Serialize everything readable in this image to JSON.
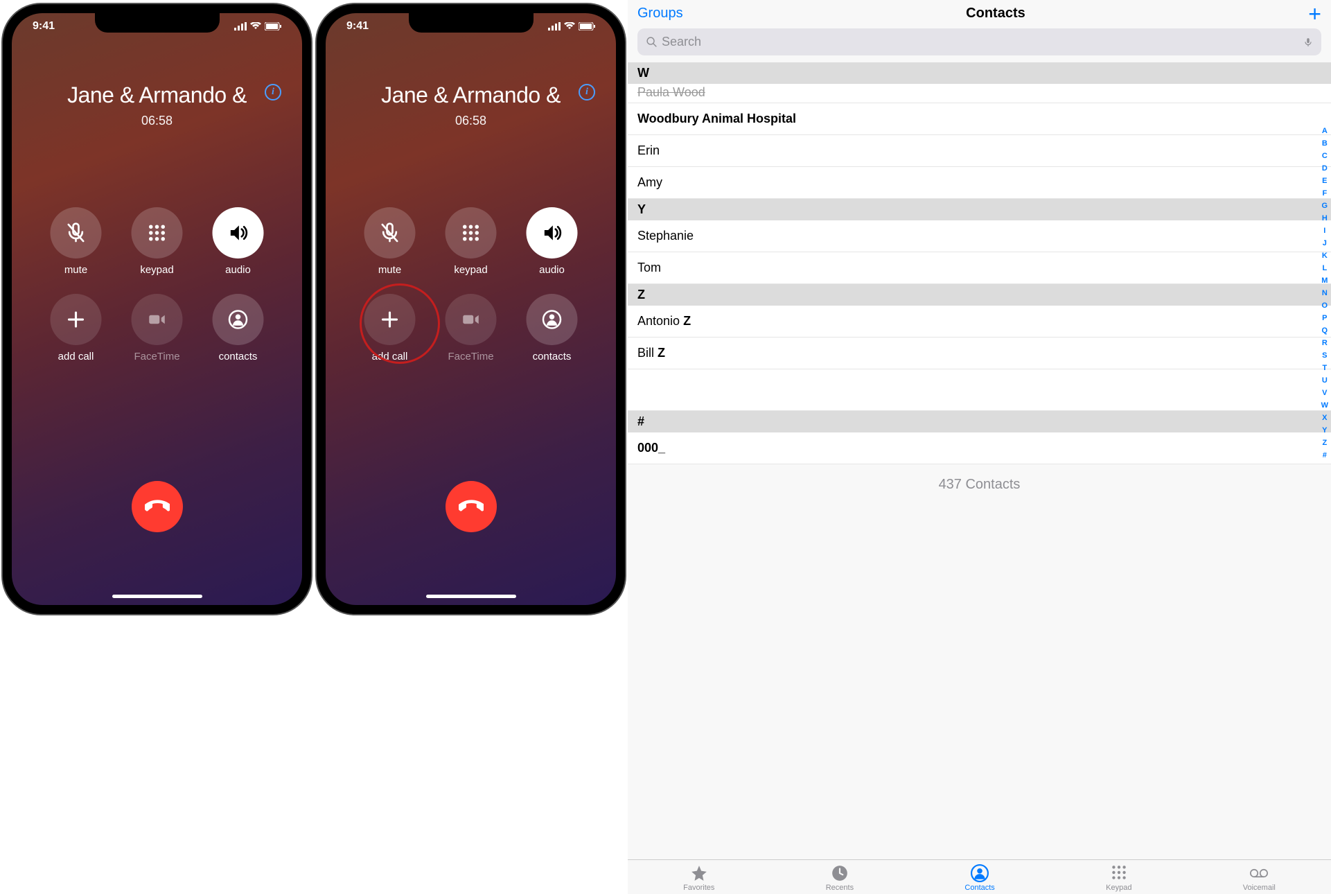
{
  "phone": {
    "time": "9:41",
    "caller": "Jane & Armando &",
    "duration": "06:58",
    "buttons": {
      "mute": "mute",
      "keypad": "keypad",
      "audio": "audio",
      "add_call": "add call",
      "facetime": "FaceTime",
      "contacts": "contacts"
    }
  },
  "contacts": {
    "groups": "Groups",
    "title": "Contacts",
    "search_placeholder": "Search",
    "sections": {
      "w": {
        "header": "W",
        "partial": "Paula Wood",
        "items": [
          "Woodbury Animal Hospital",
          "Erin",
          "Amy"
        ]
      },
      "y": {
        "header": "Y",
        "items": [
          "Stephanie",
          "Tom"
        ]
      },
      "z": {
        "header": "Z",
        "items": [
          {
            "first": "Antonio ",
            "last": "Z"
          },
          {
            "first": "Bill ",
            "last": "Z"
          }
        ]
      },
      "hash": {
        "header": "#",
        "items": [
          "000_"
        ]
      }
    },
    "count": "437 Contacts",
    "tabs": {
      "favorites": "Favorites",
      "recents": "Recents",
      "contacts": "Contacts",
      "keypad": "Keypad",
      "voicemail": "Voicemail"
    },
    "index": [
      "A",
      "B",
      "C",
      "D",
      "E",
      "F",
      "G",
      "H",
      "I",
      "J",
      "K",
      "L",
      "M",
      "N",
      "O",
      "P",
      "Q",
      "R",
      "S",
      "T",
      "U",
      "V",
      "W",
      "X",
      "Y",
      "Z",
      "#"
    ]
  }
}
